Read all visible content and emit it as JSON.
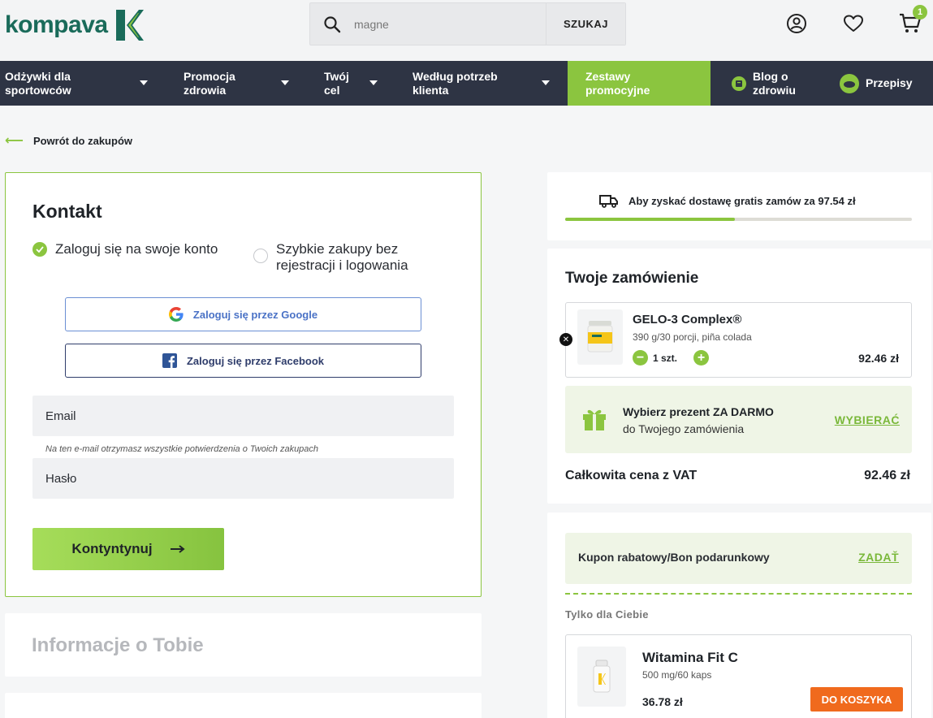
{
  "header": {
    "logo_text": "kompava",
    "search_placeholder": "magne",
    "search_button": "SZUKAJ",
    "cart_count": "1"
  },
  "nav": {
    "items": [
      {
        "label": "Odżywki dla sportowców"
      },
      {
        "label": "Promocja zdrowia"
      },
      {
        "label": "Twój cel"
      },
      {
        "label": "Według potrzeb klienta"
      },
      {
        "label": "Zestawy promocyjne"
      },
      {
        "label": "Blog o zdrowiu"
      },
      {
        "label": "Przepisy"
      }
    ]
  },
  "back_link": "Powrót do zakupów",
  "contact": {
    "title": "Kontakt",
    "option_login": "Zaloguj się na swoje konto",
    "option_quick": "Szybkie zakupy bez rejestracji i logowania",
    "google_button": "Zaloguj się przez Google",
    "facebook_button": "Zaloguj się przez Facebook",
    "email_label": "Email",
    "email_hint": "Na ten e-mail otrzymasz wszystkie potwierdzenia o Twoich zakupach",
    "password_label": "Hasło",
    "continue_button": "Kontyntynuj"
  },
  "info_section": {
    "title": "Informacje o Tobie"
  },
  "shipping": {
    "text": "Aby zyskać dostawę gratis zamów za 97.54 zł",
    "progress": 0.49
  },
  "order": {
    "title": "Twoje zamówienie",
    "product": {
      "name": "GELO-3 Complex®",
      "desc": "390 g/30 porcji, piña colada",
      "qty": "1 szt.",
      "price": "92.46 zł"
    },
    "gift": {
      "title": "Wybierz prezent ZA DARMO",
      "sub": "do Twojego zamówienia",
      "link": "WYBIERAĆ"
    },
    "total_label": "Całkowita cena z VAT",
    "total_value": "92.46 zł"
  },
  "coupon": {
    "label": "Kupon rabatowy/Bon podarunkowy",
    "link": "ZADAŤ"
  },
  "recommended": {
    "heading": "Tylko dla Ciebie",
    "name": "Witamina Fit C",
    "desc": "500 mg/60 kaps",
    "price": "36.78 zł",
    "button": "DO KOSZYKA"
  },
  "colors": {
    "accent": "#8bc53f",
    "nav_bg": "#2e3444",
    "cta_orange": "#f06a1d",
    "brand": "#1a6b5a"
  }
}
